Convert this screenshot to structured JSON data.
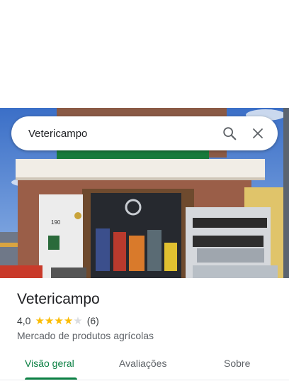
{
  "search": {
    "query": "Vetericampo"
  },
  "place": {
    "name": "Vetericampo",
    "rating": "4,0",
    "rating_value": 4,
    "rating_max": 5,
    "reviews_count": "(6)",
    "category": "Mercado de produtos agrícolas"
  },
  "photo": {
    "shop_number": "190"
  },
  "tabs": [
    {
      "label": "Visão geral",
      "active": true
    },
    {
      "label": "Avaliações",
      "active": false
    },
    {
      "label": "Sobre",
      "active": false
    }
  ],
  "colors": {
    "accent": "#0b8043",
    "star": "#fbbc04"
  }
}
